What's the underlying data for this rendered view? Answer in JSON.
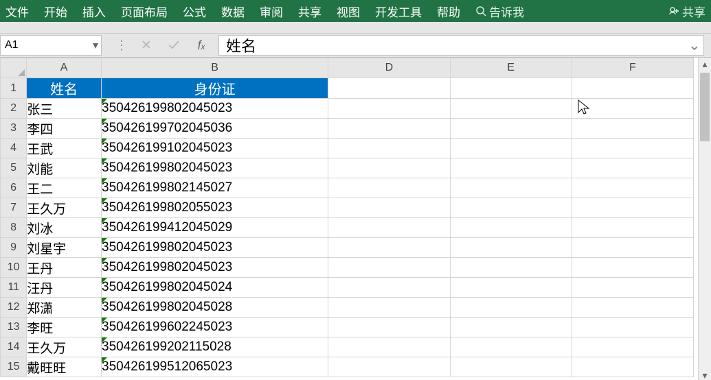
{
  "ribbon": {
    "tabs": [
      "文件",
      "开始",
      "插入",
      "页面布局",
      "公式",
      "数据",
      "审阅",
      "共享",
      "视图",
      "开发工具",
      "帮助"
    ],
    "tellme": "告诉我",
    "share": "共享"
  },
  "namebox": "A1",
  "formula_value": "姓名",
  "columns": [
    "A",
    "B",
    "D",
    "E",
    "F"
  ],
  "row_numbers": [
    "1",
    "2",
    "3",
    "4",
    "5",
    "6",
    "7",
    "8",
    "9",
    "10",
    "11",
    "12",
    "13",
    "14",
    "15"
  ],
  "headers": {
    "a": "姓名",
    "b": "身份证"
  },
  "rows": [
    {
      "a": "张三",
      "b": "350426199802045023"
    },
    {
      "a": "李四",
      "b": "350426199702045036"
    },
    {
      "a": "王武",
      "b": "350426199102045023"
    },
    {
      "a": "刘能",
      "b": "350426199802045023"
    },
    {
      "a": "王二",
      "b": "350426199802145027"
    },
    {
      "a": "王久万",
      "b": "350426199802055023"
    },
    {
      "a": "刘冰",
      "b": "350426199412045029"
    },
    {
      "a": "刘星宇",
      "b": "350426199802045023"
    },
    {
      "a": "王丹",
      "b": "350426199802045023"
    },
    {
      "a": "汪丹",
      "b": "350426199802045024"
    },
    {
      "a": "郑潇",
      "b": "350426199802045028"
    },
    {
      "a": "李旺",
      "b": "350426199602245023"
    },
    {
      "a": "王久万",
      "b": "350426199202115028"
    },
    {
      "a": "戴旺旺",
      "b": "350426199512065023"
    }
  ]
}
